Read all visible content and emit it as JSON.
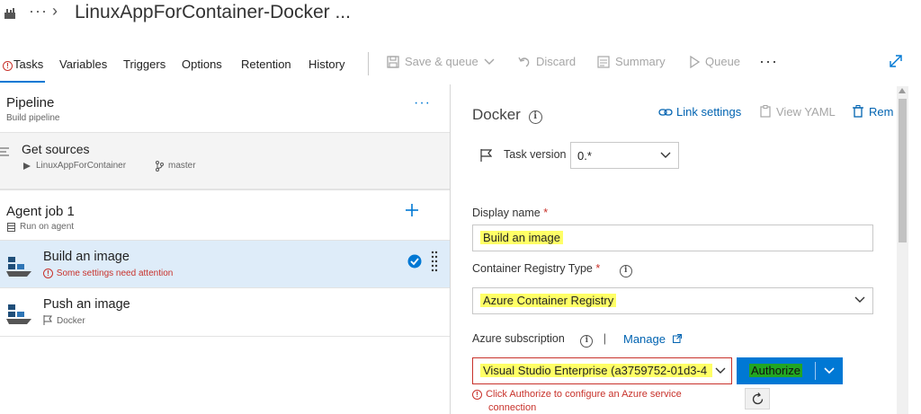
{
  "header": {
    "title": "LinuxAppForContainer-Docker ..."
  },
  "tabs": [
    {
      "label": "Tasks"
    },
    {
      "label": "Variables"
    },
    {
      "label": "Triggers"
    },
    {
      "label": "Options"
    },
    {
      "label": "Retention"
    },
    {
      "label": "History"
    }
  ],
  "toolbar": {
    "save_queue": "Save & queue",
    "discard": "Discard",
    "summary": "Summary",
    "queue": "Queue"
  },
  "pipeline": {
    "title": "Pipeline",
    "subtitle": "Build pipeline"
  },
  "get_sources": {
    "title": "Get sources",
    "repo": "LinuxAppForContainer",
    "branch": "master"
  },
  "agent_job": {
    "title": "Agent job 1",
    "subtitle": "Run on agent"
  },
  "tasks": [
    {
      "title": "Build an image",
      "status": "Some settings need attention"
    },
    {
      "title": "Push an image",
      "subtitle": "Docker"
    }
  ],
  "details": {
    "title": "Docker",
    "link_settings": "Link settings",
    "view_yaml": "View YAML",
    "remove": "Rem",
    "task_version_label": "Task version",
    "task_version_value": "0.*",
    "display_name_label": "Display name",
    "display_name_value": "Build an image",
    "registry_type_label": "Container Registry Type",
    "registry_type_value": "Azure Container Registry",
    "subscription_label": "Azure subscription",
    "manage": "Manage",
    "subscription_value": "Visual Studio Enterprise (a3759752-01d3-4",
    "authorize": "Authorize",
    "auth_error_line1": "Click Authorize to configure an Azure service",
    "auth_error_line2": "connection",
    "required_mark": "*"
  },
  "colors": {
    "accent": "#0078d4",
    "highlight": "#ffff66",
    "authorize_bg": "#0078d4",
    "authorize_label_bg": "#1e8c1e",
    "error": "#c8322b"
  }
}
